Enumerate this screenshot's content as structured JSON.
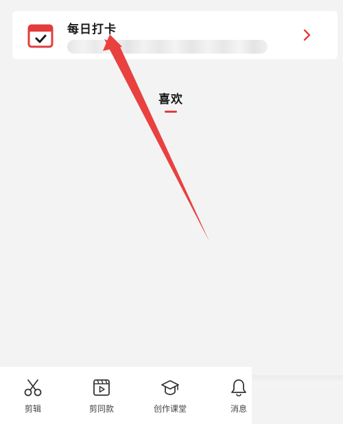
{
  "checkin_card": {
    "title": "每日打卡",
    "subtitle": "",
    "icon": "calendar-check-icon",
    "chevron_icon": "chevron-right-icon"
  },
  "tab": {
    "label": "喜欢"
  },
  "bottom_nav": {
    "items": [
      {
        "label": "剪辑",
        "icon": "scissors-icon"
      },
      {
        "label": "剪同款",
        "icon": "video-template-icon"
      },
      {
        "label": "创作课堂",
        "icon": "graduation-cap-icon"
      },
      {
        "label": "消息",
        "icon": "bell-icon"
      }
    ]
  },
  "colors": {
    "accent": "#e23c3c",
    "background": "#f3f3f3",
    "card": "#ffffff"
  }
}
